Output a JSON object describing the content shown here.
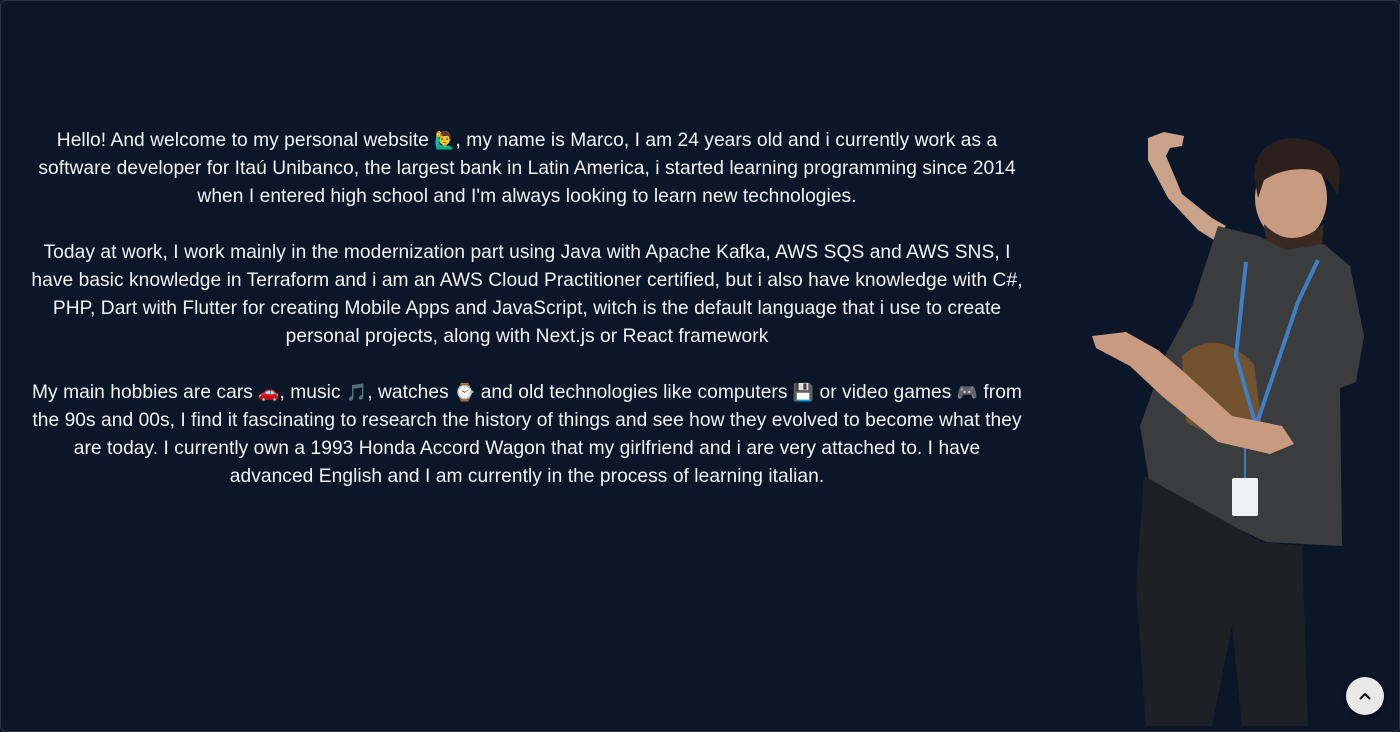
{
  "about": {
    "paragraphs": [
      [
        {
          "t": "Hello! And welcome to my personal website "
        },
        {
          "e": "🙋‍♂️",
          "icon": "person-raising-hand-icon"
        },
        {
          "t": ", my name is Marco, I am 24 years old and i currently work as a software developer for Itaú Unibanco, the largest bank in Latin America, i started learning programming since 2014 when I entered high school and I'm always looking to learn new technologies."
        }
      ],
      [
        {
          "t": "Today at work, I work mainly in the modernization part using Java with Apache Kafka, AWS SQS and AWS SNS, I have basic knowledge in Terraform and i am an AWS Cloud Practitioner certified, but i also have knowledge with C#, PHP, Dart with Flutter for creating Mobile Apps and JavaScript, witch is the default language that i use to create personal projects, along with Next.js or React framework"
        }
      ],
      [
        {
          "t": "My main hobbies are cars "
        },
        {
          "e": "🚗",
          "icon": "car-icon"
        },
        {
          "t": ", music "
        },
        {
          "e": "🎵",
          "icon": "music-note-icon"
        },
        {
          "t": ", watches "
        },
        {
          "e": "⌚",
          "icon": "watch-icon"
        },
        {
          "t": " and old technologies like computers "
        },
        {
          "e": "💾",
          "icon": "floppy-disk-icon"
        },
        {
          "t": " or video games "
        },
        {
          "e": "🎮",
          "icon": "gamepad-icon"
        },
        {
          "t": " from the 90s and 00s, I find it fascinating to research the history of things and see how they evolved to become what they are today. I currently own a 1993 Honda Accord Wagon that my girlfriend and i are very attached to. I have advanced English and I am currently in the process of learning italian."
        }
      ]
    ]
  },
  "photo": {
    "subject": "person pointing at text"
  },
  "scroll_top_button": {
    "icon": "chevron-up-icon"
  },
  "colors": {
    "background": "#0b1628",
    "text": "#f1f3f6",
    "button": "#e8e8e8"
  }
}
